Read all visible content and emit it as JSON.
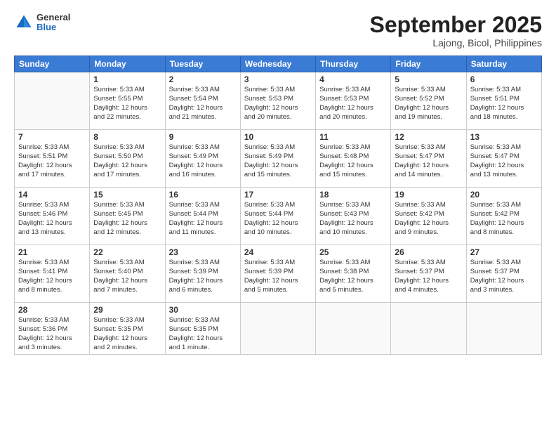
{
  "header": {
    "logo": {
      "general": "General",
      "blue": "Blue"
    },
    "month": "September 2025",
    "location": "Lajong, Bicol, Philippines"
  },
  "weekdays": [
    "Sunday",
    "Monday",
    "Tuesday",
    "Wednesday",
    "Thursday",
    "Friday",
    "Saturday"
  ],
  "weeks": [
    [
      {
        "day": "",
        "info": ""
      },
      {
        "day": "1",
        "info": "Sunrise: 5:33 AM\nSunset: 5:55 PM\nDaylight: 12 hours\nand 22 minutes."
      },
      {
        "day": "2",
        "info": "Sunrise: 5:33 AM\nSunset: 5:54 PM\nDaylight: 12 hours\nand 21 minutes."
      },
      {
        "day": "3",
        "info": "Sunrise: 5:33 AM\nSunset: 5:53 PM\nDaylight: 12 hours\nand 20 minutes."
      },
      {
        "day": "4",
        "info": "Sunrise: 5:33 AM\nSunset: 5:53 PM\nDaylight: 12 hours\nand 20 minutes."
      },
      {
        "day": "5",
        "info": "Sunrise: 5:33 AM\nSunset: 5:52 PM\nDaylight: 12 hours\nand 19 minutes."
      },
      {
        "day": "6",
        "info": "Sunrise: 5:33 AM\nSunset: 5:51 PM\nDaylight: 12 hours\nand 18 minutes."
      }
    ],
    [
      {
        "day": "7",
        "info": "Sunrise: 5:33 AM\nSunset: 5:51 PM\nDaylight: 12 hours\nand 17 minutes."
      },
      {
        "day": "8",
        "info": "Sunrise: 5:33 AM\nSunset: 5:50 PM\nDaylight: 12 hours\nand 17 minutes."
      },
      {
        "day": "9",
        "info": "Sunrise: 5:33 AM\nSunset: 5:49 PM\nDaylight: 12 hours\nand 16 minutes."
      },
      {
        "day": "10",
        "info": "Sunrise: 5:33 AM\nSunset: 5:49 PM\nDaylight: 12 hours\nand 15 minutes."
      },
      {
        "day": "11",
        "info": "Sunrise: 5:33 AM\nSunset: 5:48 PM\nDaylight: 12 hours\nand 15 minutes."
      },
      {
        "day": "12",
        "info": "Sunrise: 5:33 AM\nSunset: 5:47 PM\nDaylight: 12 hours\nand 14 minutes."
      },
      {
        "day": "13",
        "info": "Sunrise: 5:33 AM\nSunset: 5:47 PM\nDaylight: 12 hours\nand 13 minutes."
      }
    ],
    [
      {
        "day": "14",
        "info": "Sunrise: 5:33 AM\nSunset: 5:46 PM\nDaylight: 12 hours\nand 13 minutes."
      },
      {
        "day": "15",
        "info": "Sunrise: 5:33 AM\nSunset: 5:45 PM\nDaylight: 12 hours\nand 12 minutes."
      },
      {
        "day": "16",
        "info": "Sunrise: 5:33 AM\nSunset: 5:44 PM\nDaylight: 12 hours\nand 11 minutes."
      },
      {
        "day": "17",
        "info": "Sunrise: 5:33 AM\nSunset: 5:44 PM\nDaylight: 12 hours\nand 10 minutes."
      },
      {
        "day": "18",
        "info": "Sunrise: 5:33 AM\nSunset: 5:43 PM\nDaylight: 12 hours\nand 10 minutes."
      },
      {
        "day": "19",
        "info": "Sunrise: 5:33 AM\nSunset: 5:42 PM\nDaylight: 12 hours\nand 9 minutes."
      },
      {
        "day": "20",
        "info": "Sunrise: 5:33 AM\nSunset: 5:42 PM\nDaylight: 12 hours\nand 8 minutes."
      }
    ],
    [
      {
        "day": "21",
        "info": "Sunrise: 5:33 AM\nSunset: 5:41 PM\nDaylight: 12 hours\nand 8 minutes."
      },
      {
        "day": "22",
        "info": "Sunrise: 5:33 AM\nSunset: 5:40 PM\nDaylight: 12 hours\nand 7 minutes."
      },
      {
        "day": "23",
        "info": "Sunrise: 5:33 AM\nSunset: 5:39 PM\nDaylight: 12 hours\nand 6 minutes."
      },
      {
        "day": "24",
        "info": "Sunrise: 5:33 AM\nSunset: 5:39 PM\nDaylight: 12 hours\nand 5 minutes."
      },
      {
        "day": "25",
        "info": "Sunrise: 5:33 AM\nSunset: 5:38 PM\nDaylight: 12 hours\nand 5 minutes."
      },
      {
        "day": "26",
        "info": "Sunrise: 5:33 AM\nSunset: 5:37 PM\nDaylight: 12 hours\nand 4 minutes."
      },
      {
        "day": "27",
        "info": "Sunrise: 5:33 AM\nSunset: 5:37 PM\nDaylight: 12 hours\nand 3 minutes."
      }
    ],
    [
      {
        "day": "28",
        "info": "Sunrise: 5:33 AM\nSunset: 5:36 PM\nDaylight: 12 hours\nand 3 minutes."
      },
      {
        "day": "29",
        "info": "Sunrise: 5:33 AM\nSunset: 5:35 PM\nDaylight: 12 hours\nand 2 minutes."
      },
      {
        "day": "30",
        "info": "Sunrise: 5:33 AM\nSunset: 5:35 PM\nDaylight: 12 hours\nand 1 minute."
      },
      {
        "day": "",
        "info": ""
      },
      {
        "day": "",
        "info": ""
      },
      {
        "day": "",
        "info": ""
      },
      {
        "day": "",
        "info": ""
      }
    ]
  ]
}
